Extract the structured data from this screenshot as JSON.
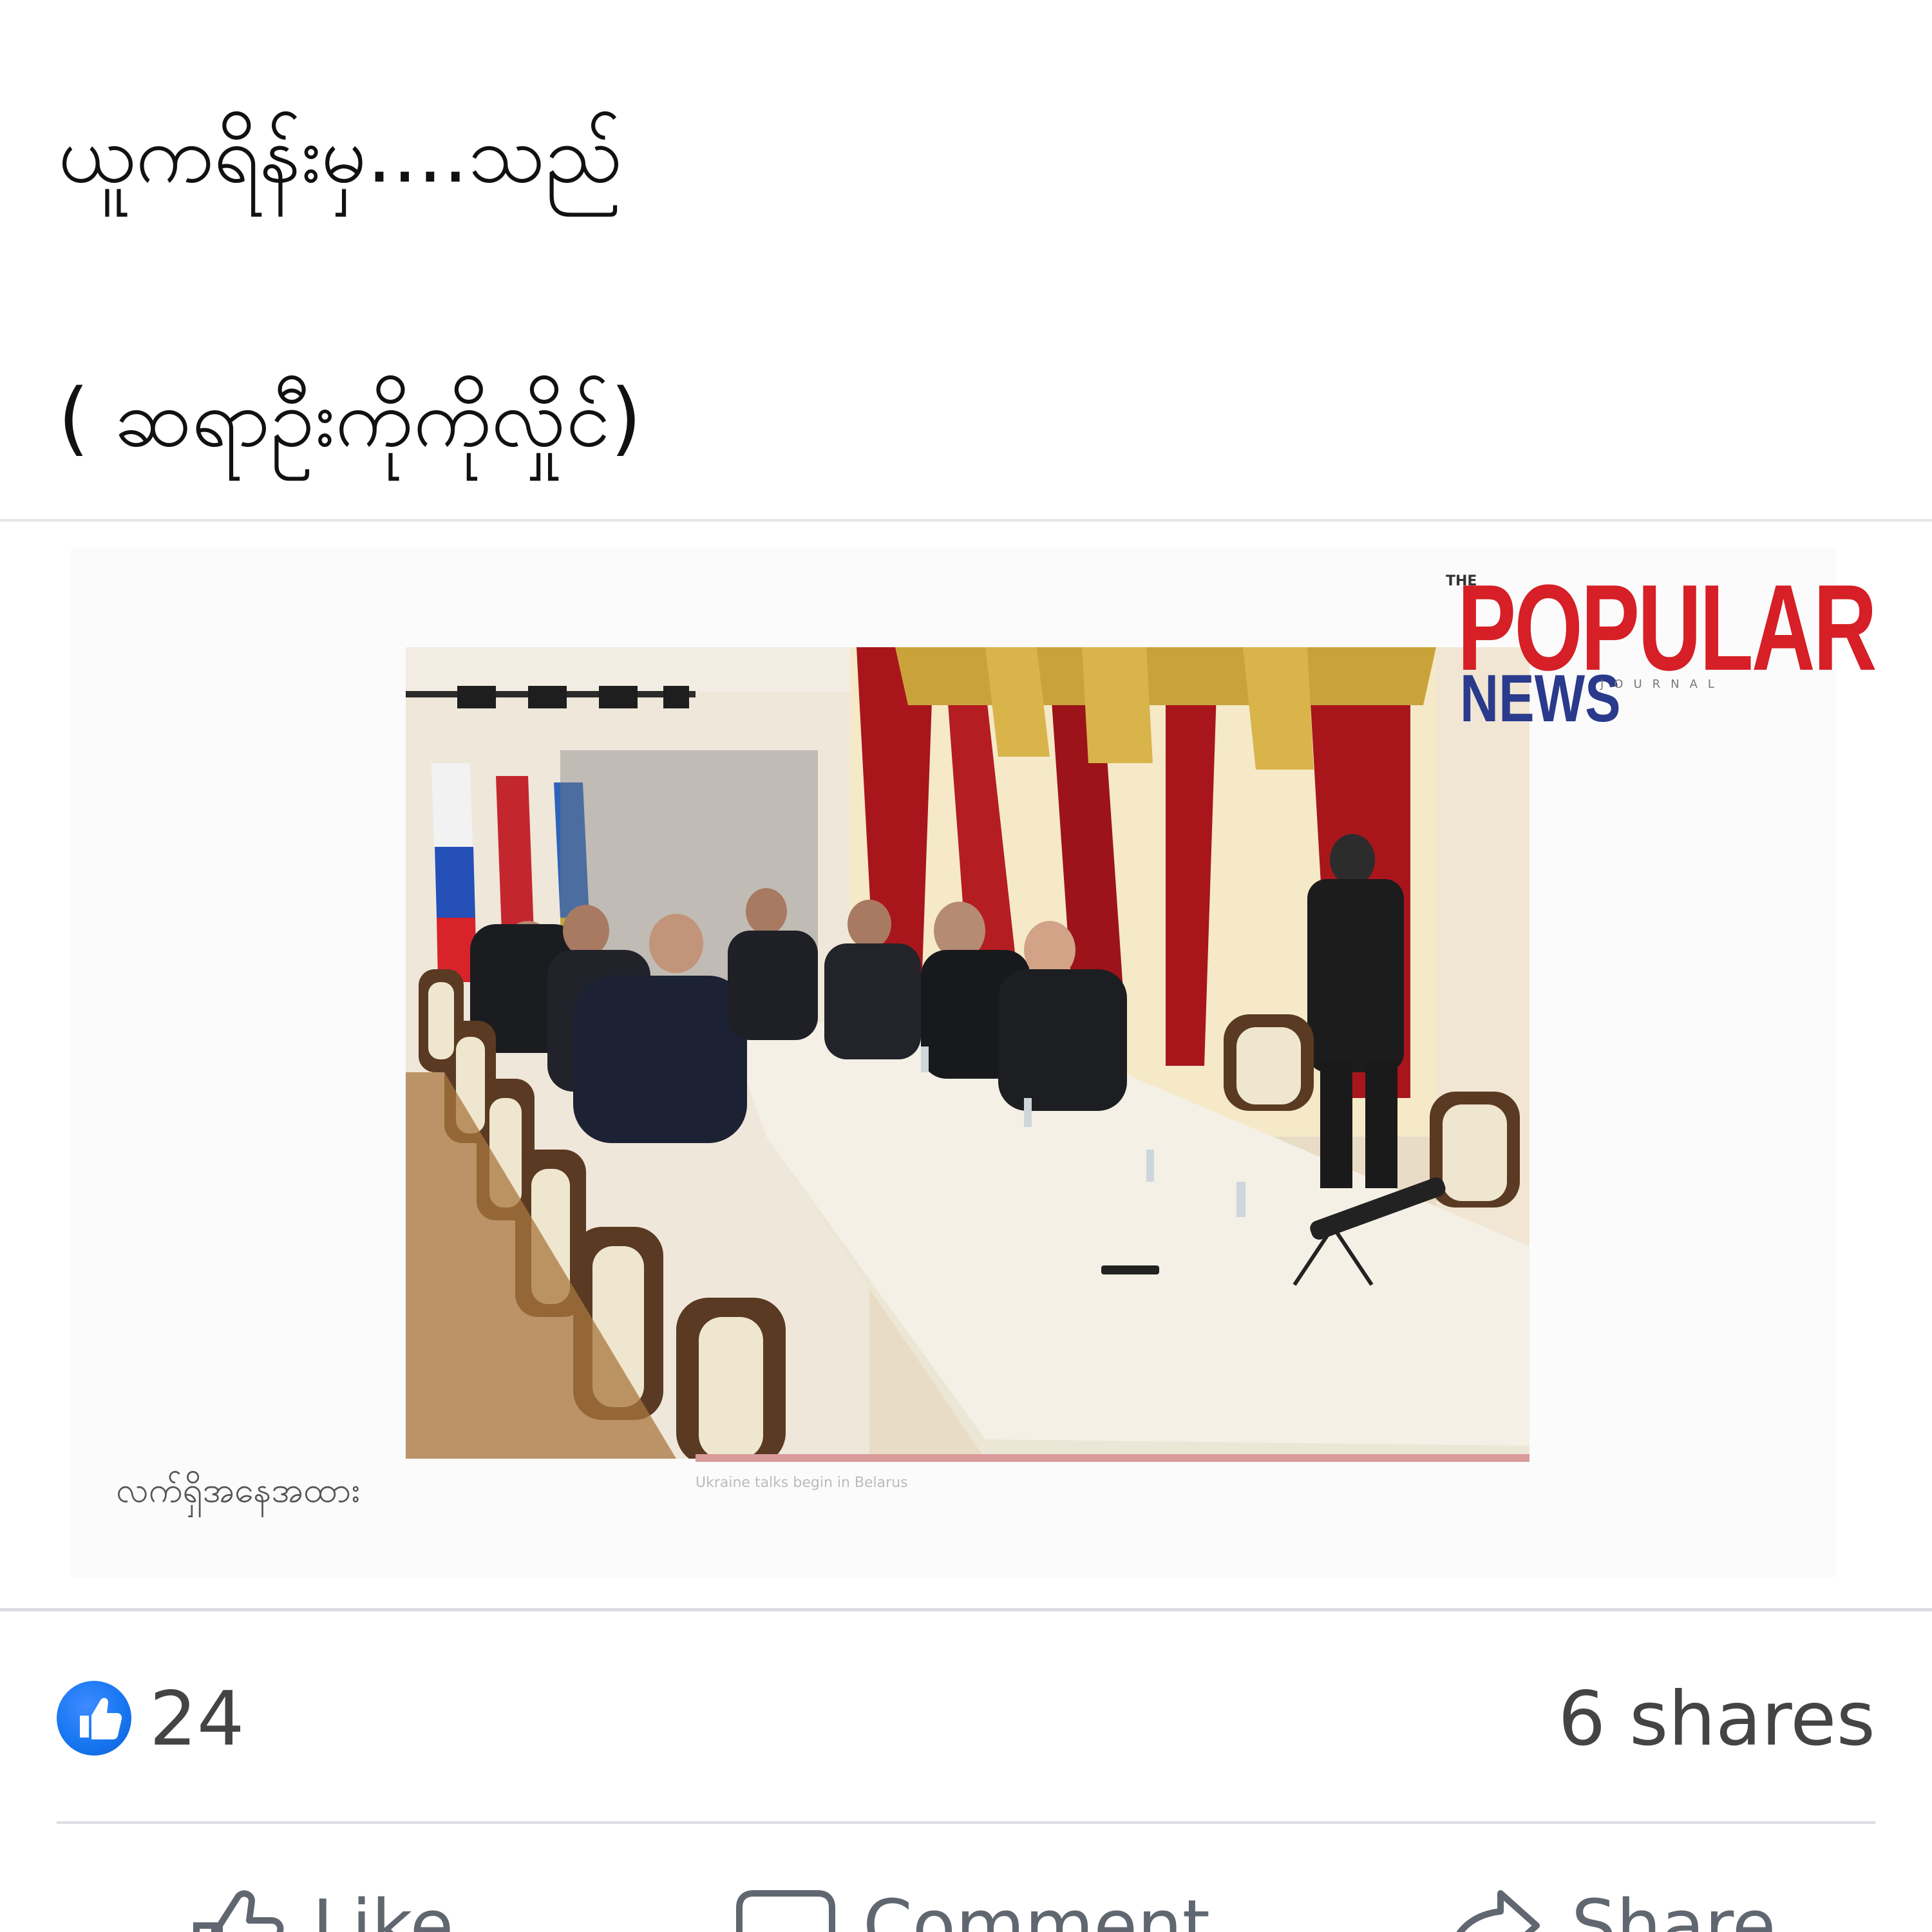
{
  "post": {
    "lines": [
      "ယူကရိန်းမှ....သည်",
      "( ဆရာဦးကိုကိုလှိုင်)"
    ]
  },
  "media": {
    "logo": {
      "the": "THE",
      "popular": "POPULAR",
      "news": "NEWS",
      "journal": "JOURNAL"
    },
    "caption_my": "လက်ရှိအနေအထား",
    "caption_en": "Ukraine talks begin in Belarus"
  },
  "summary": {
    "like_count": "24",
    "shares": "6 shares"
  },
  "actions": {
    "like": "Like",
    "comment": "Comment",
    "share": "Share"
  },
  "colors": {
    "accent": "#1877f2",
    "logo_red": "#d61f26",
    "logo_blue": "#2a3a8c",
    "muted_text": "#606770"
  },
  "icons": [
    "like-badge-icon",
    "thumbs-up-icon",
    "comment-icon",
    "share-icon"
  ]
}
